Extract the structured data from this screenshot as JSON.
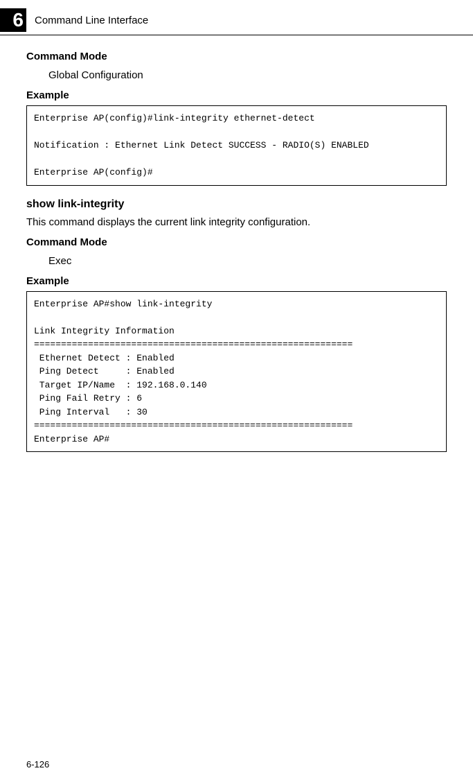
{
  "header": {
    "chapter_number": "6",
    "chapter_title": "Command Line Interface"
  },
  "sections": {
    "command_mode_1": {
      "heading": "Command Mode",
      "value": "Global Configuration"
    },
    "example_1": {
      "heading": "Example",
      "code": "Enterprise AP(config)#link-integrity ethernet-detect\n\nNotification : Ethernet Link Detect SUCCESS - RADIO(S) ENABLED\n\nEnterprise AP(config)#"
    },
    "show_link_integrity": {
      "title": "show link-integrity",
      "description": "This command displays the current link integrity configuration."
    },
    "command_mode_2": {
      "heading": "Command Mode",
      "value": "Exec"
    },
    "example_2": {
      "heading": "Example",
      "code": "Enterprise AP#show link-integrity\n\nLink Integrity Information\n===========================================================\n Ethernet Detect : Enabled\n Ping Detect     : Enabled\n Target IP/Name  : 192.168.0.140\n Ping Fail Retry : 6\n Ping Interval   : 30\n===========================================================\nEnterprise AP#"
    }
  },
  "page_number": "6-126"
}
